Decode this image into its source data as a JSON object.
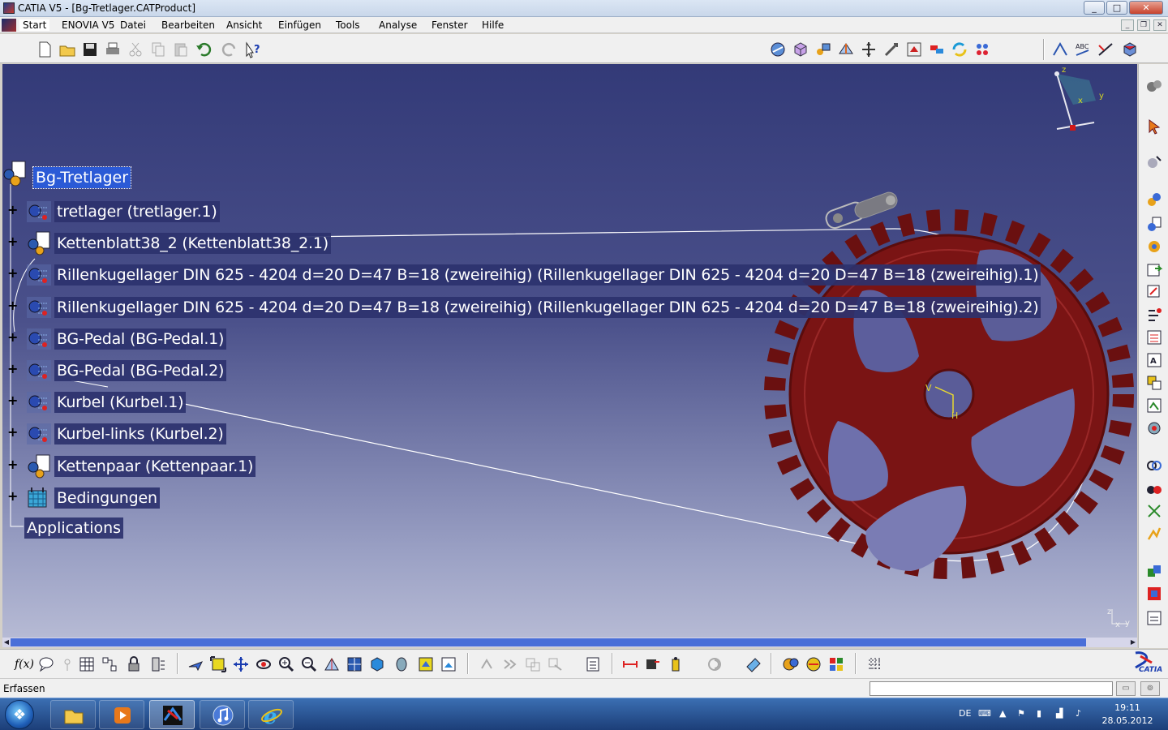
{
  "window": {
    "title": "CATIA V5 - [Bg-Tretlager.CATProduct]",
    "min_label": "_",
    "max_label": "□",
    "close_label": "✕"
  },
  "menubar": {
    "items": [
      "Start",
      "ENOVIA V5",
      "Datei",
      "Bearbeiten",
      "Ansicht",
      "Einfügen",
      "Tools",
      "Analyse",
      "Fenster",
      "Hilfe"
    ]
  },
  "tree": {
    "root": "Bg-Tretlager",
    "nodes": [
      {
        "label": "tretlager (tretlager.1)",
        "icon": "part-instance-icon"
      },
      {
        "label": "Kettenblatt38_2 (Kettenblatt38_2.1)",
        "icon": "product-instance-icon"
      },
      {
        "label": "Rillenkugellager DIN 625 - 4204 d=20 D=47 B=18 (zweireihig) (Rillenkugellager DIN 625 - 4204 d=20 D=47 B=18 (zweireihig).1)",
        "icon": "part-instance-icon"
      },
      {
        "label": "Rillenkugellager DIN 625 - 4204 d=20 D=47 B=18 (zweireihig) (Rillenkugellager DIN 625 - 4204 d=20 D=47 B=18 (zweireihig).2)",
        "icon": "part-instance-icon"
      },
      {
        "label": "BG-Pedal (BG-Pedal.1)",
        "icon": "part-instance-icon"
      },
      {
        "label": "BG-Pedal (BG-Pedal.2)",
        "icon": "part-instance-icon"
      },
      {
        "label": "Kurbel (Kurbel.1)",
        "icon": "part-instance-icon"
      },
      {
        "label": "Kurbel-links (Kurbel.2)",
        "icon": "part-instance-icon"
      },
      {
        "label": "Kettenpaar (Kettenpaar.1)",
        "icon": "product-instance-icon"
      },
      {
        "label": "Bedingungen",
        "icon": "constraints-icon"
      }
    ],
    "applications": "Applications"
  },
  "compass": {
    "x": "x",
    "y": "y",
    "z": "z"
  },
  "axis_mini": {
    "x": "x",
    "y": "y",
    "z": "z"
  },
  "sprocket_axis": {
    "v": "V",
    "h": "H"
  },
  "status": {
    "text": "Erfassen",
    "command_value": ""
  },
  "taskbar": {
    "lang": "DE",
    "time": "19:11",
    "date": "28.05.2012"
  },
  "logo": {
    "text": "CATIA"
  },
  "colors": {
    "sprocket": "#7a1414",
    "viewport_top": "#333a78",
    "selection": "#2b5ad6"
  }
}
